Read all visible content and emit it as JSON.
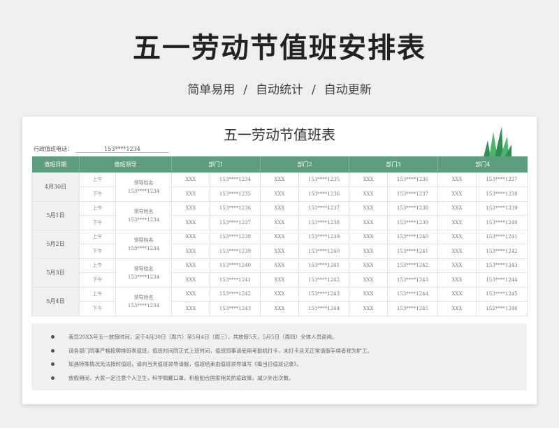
{
  "header": {
    "title": "五一劳动节值班安排表",
    "tags": [
      "简单易用",
      "自动统计",
      "自动更新"
    ],
    "separator": "/"
  },
  "sheet": {
    "title": "五一劳动节值班表",
    "phone_label": "行政值班电话：",
    "phone_value": "153****1234"
  },
  "table": {
    "headers": [
      "值班日期",
      "值班领导",
      "部门1",
      "部门2",
      "部门3",
      "部门4"
    ],
    "days": [
      {
        "date": "4月30日",
        "leader_name": "领导姓名",
        "leader_phone": "153****1234",
        "shifts": [
          {
            "label": "上午",
            "cells": [
              "XXX",
              "153****1234",
              "XXX",
              "153****1235",
              "XXX",
              "153****1236",
              "XXX",
              "153****1237"
            ]
          },
          {
            "label": "下午",
            "cells": [
              "XXX",
              "153****1235",
              "XXX",
              "153****1236",
              "XXX",
              "153****1237",
              "XXX",
              "153****1238"
            ]
          }
        ]
      },
      {
        "date": "5月1日",
        "leader_name": "领导姓名",
        "leader_phone": "153****1234",
        "shifts": [
          {
            "label": "上午",
            "cells": [
              "XXX",
              "153****1236",
              "XXX",
              "153****1237",
              "XXX",
              "153****1238",
              "XXX",
              "153****1239"
            ]
          },
          {
            "label": "下午",
            "cells": [
              "XXX",
              "153****1237",
              "XXX",
              "153****1238",
              "XXX",
              "153****1239",
              "XXX",
              "153****1240"
            ]
          }
        ]
      },
      {
        "date": "5月2日",
        "leader_name": "领导姓名",
        "leader_phone": "153****1234",
        "shifts": [
          {
            "label": "上午",
            "cells": [
              "XXX",
              "153****1238",
              "XXX",
              "153****1239",
              "XXX",
              "153****1240",
              "XXX",
              "153****1241"
            ]
          },
          {
            "label": "下午",
            "cells": [
              "XXX",
              "153****1239",
              "XXX",
              "153****1240",
              "XXX",
              "153****1241",
              "XXX",
              "153****1242"
            ]
          }
        ]
      },
      {
        "date": "5月3日",
        "leader_name": "领导姓名",
        "leader_phone": "153****1234",
        "shifts": [
          {
            "label": "上午",
            "cells": [
              "XXX",
              "153****1240",
              "XXX",
              "153****1241",
              "XXX",
              "153****1242",
              "XXX",
              "153****1243"
            ]
          },
          {
            "label": "下午",
            "cells": [
              "XXX",
              "153****1241",
              "XXX",
              "153****1242",
              "XXX",
              "153****1243",
              "XXX",
              "153****1244"
            ]
          }
        ]
      },
      {
        "date": "5月4日",
        "leader_name": "领导姓名",
        "leader_phone": "153****1234",
        "shifts": [
          {
            "label": "上午",
            "cells": [
              "XXX",
              "153****1242",
              "XXX",
              "153****1243",
              "XXX",
              "153****1244",
              "XXX",
              "153****1245"
            ]
          },
          {
            "label": "下午",
            "cells": [
              "XXX",
              "153****1243",
              "XXX",
              "153****1244",
              "XXX",
              "153****1245",
              "XXX",
              "152****1246"
            ]
          }
        ]
      }
    ]
  },
  "notes": [
    "我司20XX年五一放假时间，定于4月30日（周六）至5月4日（周三），共放假5天，5月5日（周四）全体人员返岗。",
    "请各部门同事严格按照排班表值班，值班时间同正式上班时间，值班同事请使用考勤机打卡，未打卡且无正常请假手续者视为旷工。",
    "如遇特殊情况无法按时值班，请向当天值班领导请假，值班结束由值班领导填写《每当日值班记录》。",
    "放假期间，大家一定注意个人卫生，科学佩戴口罩，积极配合国家相关防疫政策，减少外出次数。"
  ],
  "colors": {
    "header_green": "#5f9e7c",
    "grass_dark": "#2f8f52",
    "grass_light": "#4cb56b"
  },
  "icons": {
    "decoration": "grass-icon",
    "bullet": "bullet-dot-icon"
  }
}
